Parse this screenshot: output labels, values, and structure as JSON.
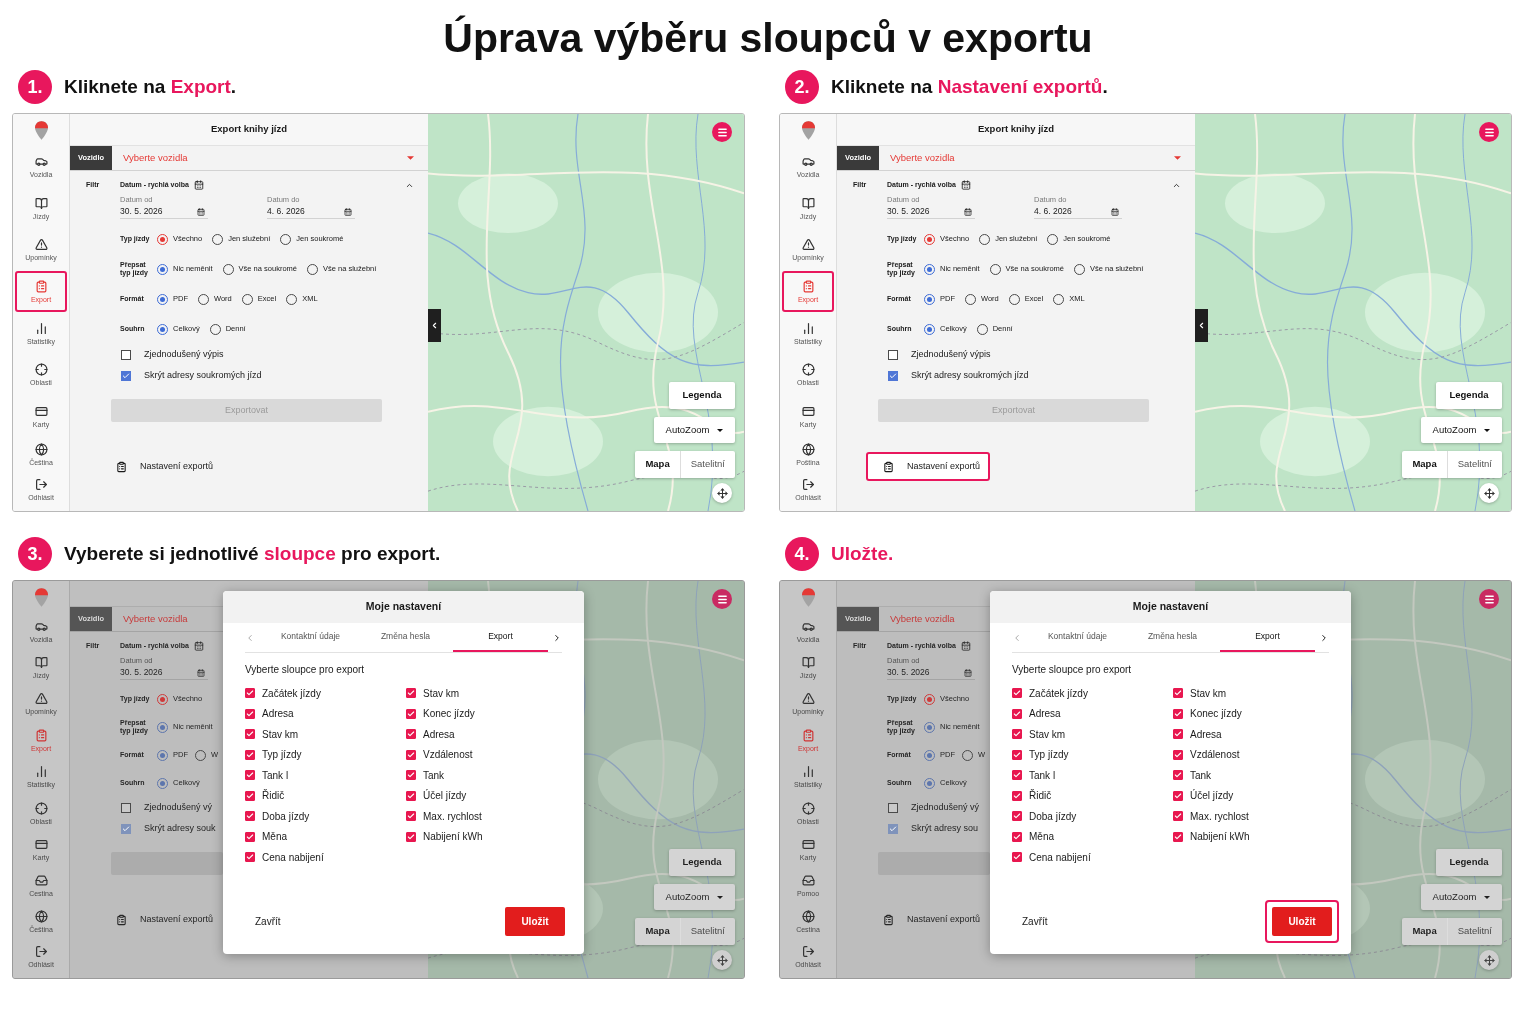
{
  "title": "Úprava výběru sloupců v exportu",
  "steps": [
    {
      "number": "1.",
      "heading": [
        {
          "text": "Kliknete na ",
          "accent": false
        },
        {
          "text": "Export",
          "accent": true
        },
        {
          "text": ".",
          "accent": false
        }
      ],
      "app": {
        "dimmed": false,
        "sidebar": {
          "items": [
            {
              "label": "Vozidla",
              "kind": "car",
              "selected": false,
              "highlighted": false
            },
            {
              "label": "Jízdy",
              "kind": "book",
              "selected": false,
              "highlighted": false
            },
            {
              "label": "Upomínky",
              "kind": "warning",
              "selected": false,
              "highlighted": false
            },
            {
              "label": "Export",
              "kind": "clipboard",
              "selected": true,
              "highlighted": true
            },
            {
              "label": "Statistiky",
              "kind": "chart",
              "selected": false,
              "highlighted": false
            },
            {
              "label": "Oblasti",
              "kind": "target",
              "selected": false,
              "highlighted": false
            },
            {
              "label": "Karty",
              "kind": "card",
              "selected": false,
              "highlighted": false
            }
          ],
          "bottom_items": [
            {
              "label": "Čeština",
              "kind": "globe",
              "selected": false,
              "highlighted": false
            },
            {
              "label": "Odhlásit",
              "kind": "exit",
              "selected": false,
              "highlighted": false
            }
          ]
        },
        "form": {
          "title": "Export knihy jízd",
          "vehicle_tab": "Vozidlo",
          "vehicle_select": "Vyberte vozidla",
          "filter_label": "Filtr",
          "date_quick": "Datum - rychlá volba",
          "dates": [
            {
              "label": "Datum od",
              "value": "30. 5. 2026"
            },
            {
              "label": "Datum do",
              "value": "4. 6. 2026"
            }
          ],
          "groups": [
            {
              "label": "Typ jízdy",
              "color": "#e53935",
              "options": [
                {
                  "label": "Všechno",
                  "selected": true
                },
                {
                  "label": "Jen služební",
                  "selected": false
                },
                {
                  "label": "Jen soukromé",
                  "selected": false
                }
              ]
            },
            {
              "label": "Přepsat typ jízdy",
              "color": "#3d6cd6",
              "options": [
                {
                  "label": "Nic neměnit",
                  "selected": true
                },
                {
                  "label": "Vše na soukromé",
                  "selected": false
                },
                {
                  "label": "Vše na služební",
                  "selected": false
                }
              ]
            },
            {
              "label": "Formát",
              "color": "#3d6cd6",
              "options": [
                {
                  "label": "PDF",
                  "selected": true
                },
                {
                  "label": "Word",
                  "selected": false
                },
                {
                  "label": "Excel",
                  "selected": false
                },
                {
                  "label": "XML",
                  "selected": false
                }
              ]
            },
            {
              "label": "Souhrn",
              "color": "#3d6cd6",
              "options": [
                {
                  "label": "Celkový",
                  "selected": true
                },
                {
                  "label": "Denní",
                  "selected": false
                }
              ]
            }
          ],
          "checkboxes": [
            {
              "label": "Zjednodušený výpis",
              "checked": false
            },
            {
              "label": "Skrýt adresy soukromých jízd",
              "checked": true
            }
          ],
          "export_button": {
            "label": "Exportovat",
            "disabled": true
          },
          "settings_link": {
            "label": "Nastavení exportů",
            "highlighted": false
          }
        },
        "map": {
          "side_toggle": true,
          "legend_button": "Legenda",
          "zoom_dropdown": "AutoZoom",
          "map_types": [
            {
              "label": "Mapa",
              "selected": true
            },
            {
              "label": "Satelitní",
              "selected": false
            }
          ]
        }
      }
    },
    {
      "number": "2.",
      "heading": [
        {
          "text": "Kliknete na ",
          "accent": false
        },
        {
          "text": "Nastavení exportů",
          "accent": true
        },
        {
          "text": ".",
          "accent": false
        }
      ],
      "app": {
        "dimmed": false,
        "sidebar": {
          "items": [
            {
              "label": "Vozidla",
              "kind": "car",
              "selected": false,
              "highlighted": false
            },
            {
              "label": "Jízdy",
              "kind": "book",
              "selected": false,
              "highlighted": false
            },
            {
              "label": "Upomínky",
              "kind": "warning",
              "selected": false,
              "highlighted": false
            },
            {
              "label": "Export",
              "kind": "clipboard",
              "selected": true,
              "highlighted": true
            },
            {
              "label": "Statistiky",
              "kind": "chart",
              "selected": false,
              "highlighted": false
            },
            {
              "label": "Oblasti",
              "kind": "target",
              "selected": false,
              "highlighted": false
            },
            {
              "label": "Karty",
              "kind": "card",
              "selected": false,
              "highlighted": false
            }
          ],
          "bottom_items": [
            {
              "label": "Poština",
              "kind": "globe",
              "selected": false,
              "highlighted": false
            },
            {
              "label": "Odhlásit",
              "kind": "exit",
              "selected": false,
              "highlighted": false
            }
          ]
        },
        "form": {
          "title": "Export knihy jízd",
          "vehicle_tab": "Vozidlo",
          "vehicle_select": "Vyberte vozidla",
          "filter_label": "Filtr",
          "date_quick": "Datum - rychlá volba",
          "dates": [
            {
              "label": "Datum od",
              "value": "30. 5. 2026"
            },
            {
              "label": "Datum do",
              "value": "4. 6. 2026"
            }
          ],
          "groups": [
            {
              "label": "Typ jízdy",
              "color": "#e53935",
              "options": [
                {
                  "label": "Všechno",
                  "selected": true
                },
                {
                  "label": "Jen služební",
                  "selected": false
                },
                {
                  "label": "Jen soukromé",
                  "selected": false
                }
              ]
            },
            {
              "label": "Přepsat typ jízdy",
              "color": "#3d6cd6",
              "options": [
                {
                  "label": "Nic neměnit",
                  "selected": true
                },
                {
                  "label": "Vše na soukromé",
                  "selected": false
                },
                {
                  "label": "Vše na služební",
                  "selected": false
                }
              ]
            },
            {
              "label": "Formát",
              "color": "#3d6cd6",
              "options": [
                {
                  "label": "PDF",
                  "selected": true
                },
                {
                  "label": "Word",
                  "selected": false
                },
                {
                  "label": "Excel",
                  "selected": false
                },
                {
                  "label": "XML",
                  "selected": false
                }
              ]
            },
            {
              "label": "Souhrn",
              "color": "#3d6cd6",
              "options": [
                {
                  "label": "Celkový",
                  "selected": true
                },
                {
                  "label": "Denní",
                  "selected": false
                }
              ]
            }
          ],
          "checkboxes": [
            {
              "label": "Zjednodušený výpis",
              "checked": false
            },
            {
              "label": "Skrýt adresy soukromých jízd",
              "checked": true
            }
          ],
          "export_button": {
            "label": "Exportovat",
            "disabled": true
          },
          "settings_link": {
            "label": "Nastavení exportů",
            "highlighted": true
          }
        },
        "map": {
          "side_toggle": true,
          "legend_button": "Legenda",
          "zoom_dropdown": "AutoZoom",
          "map_types": [
            {
              "label": "Mapa",
              "selected": true
            },
            {
              "label": "Satelitní",
              "selected": false
            }
          ]
        }
      }
    },
    {
      "number": "3.",
      "heading": [
        {
          "text": "Vyberete si jednotlivé ",
          "accent": false
        },
        {
          "text": "sloupce",
          "accent": true
        },
        {
          "text": " pro export.",
          "accent": false
        }
      ],
      "app": {
        "dimmed": true,
        "sidebar": {
          "items": [
            {
              "label": "Vozidla",
              "kind": "car",
              "selected": false,
              "highlighted": false
            },
            {
              "label": "Jízdy",
              "kind": "book",
              "selected": false,
              "highlighted": false
            },
            {
              "label": "Upomínky",
              "kind": "warning",
              "selected": false,
              "highlighted": false
            },
            {
              "label": "Export",
              "kind": "clipboard",
              "selected": true,
              "highlighted": false
            },
            {
              "label": "Statistiky",
              "kind": "chart",
              "selected": false,
              "highlighted": false
            },
            {
              "label": "Oblasti",
              "kind": "target",
              "selected": false,
              "highlighted": false
            },
            {
              "label": "Karty",
              "kind": "card",
              "selected": false,
              "highlighted": false
            },
            {
              "label": "Cestina",
              "kind": "tray",
              "selected": false,
              "highlighted": false
            }
          ],
          "bottom_items": [
            {
              "label": "Čeština",
              "kind": "globe",
              "selected": false,
              "highlighted": false
            },
            {
              "label": "Odhlásit",
              "kind": "exit",
              "selected": false,
              "highlighted": false
            }
          ]
        },
        "form": {
          "vehicle_tab": "Vozidlo",
          "vehicle_select": "Vyberte vozidla",
          "filter_label": "Filtr",
          "date_quick": "Datum - rychlá volba",
          "dates": [
            {
              "label": "Datum od",
              "value": "30. 5. 2026"
            }
          ],
          "groups": [
            {
              "label": "Typ jízdy",
              "color": "#cf3a3a",
              "options": [
                {
                  "label": "Všechno",
                  "selected": true
                }
              ]
            },
            {
              "label": "Přepsat typ jízdy",
              "color": "#5d76ad",
              "options": [
                {
                  "label": "Nic neměnit",
                  "selected": true
                }
              ]
            },
            {
              "label": "Formát",
              "color": "#5d76ad",
              "options": [
                {
                  "label": "PDF",
                  "selected": true
                },
                {
                  "label": "W",
                  "selected": false
                }
              ]
            },
            {
              "label": "Souhrn",
              "color": "#5d76ad",
              "options": [
                {
                  "label": "Celkový",
                  "selected": true
                }
              ]
            }
          ],
          "checkboxes": [
            {
              "label": "Zjednodušený vý",
              "checked": false
            },
            {
              "label": "Skrýt adresy souk",
              "checked": true
            }
          ],
          "export_button": {
            "disabled": true
          },
          "settings_link": {
            "label": "Nastavení exportů",
            "highlighted": false
          }
        },
        "map": {
          "legend_button": "Legenda",
          "zoom_dropdown": "AutoZoom",
          "map_types": [
            {
              "label": "Mapa",
              "selected": true
            },
            {
              "label": "Satelitní",
              "selected": false
            }
          ]
        },
        "dialog": {
          "title": "Moje nastavení",
          "tabs": [
            {
              "label": "Kontaktní údaje",
              "selected": false
            },
            {
              "label": "Změna hesla",
              "selected": false
            },
            {
              "label": "Export",
              "selected": true
            }
          ],
          "section_title": "Vyberte sloupce pro export",
          "columns": [
            {
              "items": [
                {
                  "label": "Začátek jízdy",
                  "checked": true
                },
                {
                  "label": "Adresa",
                  "checked": true
                },
                {
                  "label": "Stav km",
                  "checked": true
                },
                {
                  "label": "Typ jízdy",
                  "checked": true
                },
                {
                  "label": "Tank l",
                  "checked": true
                },
                {
                  "label": "Řidič",
                  "checked": true
                },
                {
                  "label": "Doba jízdy",
                  "checked": true
                },
                {
                  "label": "Měna",
                  "checked": true
                },
                {
                  "label": "Cena nabijení",
                  "checked": true
                }
              ]
            },
            {
              "items": [
                {
                  "label": "Stav km",
                  "checked": true
                },
                {
                  "label": "Konec jízdy",
                  "checked": true
                },
                {
                  "label": "Adresa",
                  "checked": true
                },
                {
                  "label": "Vzdálenost",
                  "checked": true
                },
                {
                  "label": "Tank",
                  "checked": true
                },
                {
                  "label": "Účel jízdy",
                  "checked": true
                },
                {
                  "label": "Max. rychlost",
                  "checked": true
                },
                {
                  "label": "Nabijení kWh",
                  "checked": true
                }
              ]
            }
          ],
          "close_button": "Zavřít",
          "save_button": {
            "label": "Uložit",
            "highlighted": false
          }
        }
      }
    },
    {
      "number": "4.",
      "heading": [
        {
          "text": "Uložte.",
          "accent": true
        }
      ],
      "app": {
        "dimmed": true,
        "sidebar": {
          "items": [
            {
              "label": "Vozidla",
              "kind": "car",
              "selected": false,
              "highlighted": false
            },
            {
              "label": "Jízdy",
              "kind": "book",
              "selected": false,
              "highlighted": false
            },
            {
              "label": "Upomínky",
              "kind": "warning",
              "selected": false,
              "highlighted": false
            },
            {
              "label": "Export",
              "kind": "clipboard",
              "selected": true,
              "highlighted": false
            },
            {
              "label": "Statistiky",
              "kind": "chart",
              "selected": false,
              "highlighted": false
            },
            {
              "label": "Oblasti",
              "kind": "target",
              "selected": false,
              "highlighted": false
            },
            {
              "label": "Karty",
              "kind": "card",
              "selected": false,
              "highlighted": false
            },
            {
              "label": "Pomoo",
              "kind": "tray",
              "selected": false,
              "highlighted": false
            }
          ],
          "bottom_items": [
            {
              "label": "Cestina",
              "kind": "globe",
              "selected": false,
              "highlighted": false
            },
            {
              "label": "Odhlásit",
              "kind": "exit",
              "selected": false,
              "highlighted": false
            }
          ]
        },
        "form": {
          "vehicle_tab": "Vozidlo",
          "vehicle_select": "Vyberte vozidla",
          "filter_label": "Filtr",
          "date_quick": "Datum - rychlá volba",
          "dates": [
            {
              "label": "Datum od",
              "value": "30. 5. 2026"
            }
          ],
          "groups": [
            {
              "label": "Typ jízdy",
              "color": "#cf3a3a",
              "options": [
                {
                  "label": "Všechno",
                  "selected": true
                }
              ]
            },
            {
              "label": "Přepsat typ jízdy",
              "color": "#5d76ad",
              "options": [
                {
                  "label": "Nic neměnit",
                  "selected": true
                }
              ]
            },
            {
              "label": "Formát",
              "color": "#5d76ad",
              "options": [
                {
                  "label": "PDF",
                  "selected": true
                },
                {
                  "label": "W",
                  "selected": false
                }
              ]
            },
            {
              "label": "Souhrn",
              "color": "#5d76ad",
              "options": [
                {
                  "label": "Celkový",
                  "selected": true
                }
              ]
            }
          ],
          "checkboxes": [
            {
              "label": "Zjednodušený vý",
              "checked": false
            },
            {
              "label": "Skrýt adresy sou",
              "checked": true
            }
          ],
          "export_button": {
            "disabled": true
          },
          "settings_link": {
            "label": "Nastavení exportů",
            "highlighted": false
          }
        },
        "map": {
          "legend_button": "Legenda",
          "zoom_dropdown": "AutoZoom",
          "map_types": [
            {
              "label": "Mapa",
              "selected": true
            },
            {
              "label": "Satelitní",
              "selected": false
            }
          ]
        },
        "dialog": {
          "title": "Moje nastavení",
          "tabs": [
            {
              "label": "Kontaktní údaje",
              "selected": false
            },
            {
              "label": "Změna hesla",
              "selected": false
            },
            {
              "label": "Export",
              "selected": true
            }
          ],
          "section_title": "Vyberte sloupce pro export",
          "columns": [
            {
              "items": [
                {
                  "label": "Začátek jízdy",
                  "checked": true
                },
                {
                  "label": "Adresa",
                  "checked": true
                },
                {
                  "label": "Stav km",
                  "checked": true
                },
                {
                  "label": "Typ jízdy",
                  "checked": true
                },
                {
                  "label": "Tank l",
                  "checked": true
                },
                {
                  "label": "Řidič",
                  "checked": true
                },
                {
                  "label": "Doba jízdy",
                  "checked": true
                },
                {
                  "label": "Měna",
                  "checked": true
                },
                {
                  "label": "Cena nabijení",
                  "checked": true
                }
              ]
            },
            {
              "items": [
                {
                  "label": "Stav km",
                  "checked": true
                },
                {
                  "label": "Konec jízdy",
                  "checked": true
                },
                {
                  "label": "Adresa",
                  "checked": true
                },
                {
                  "label": "Vzdálenost",
                  "checked": true
                },
                {
                  "label": "Tank",
                  "checked": true
                },
                {
                  "label": "Účel jízdy",
                  "checked": true
                },
                {
                  "label": "Max. rychlost",
                  "checked": true
                },
                {
                  "label": "Nabijení kWh",
                  "checked": true
                }
              ]
            }
          ],
          "close_button": "Zavřít",
          "save_button": {
            "label": "Uložit",
            "highlighted": true
          }
        }
      }
    }
  ]
}
